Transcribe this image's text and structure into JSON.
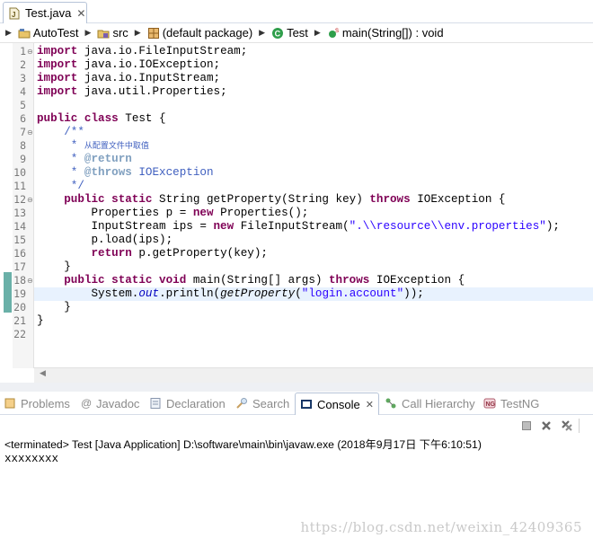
{
  "editor_tab": {
    "label": "Test.java",
    "close": "✕"
  },
  "breadcrumb": [
    {
      "label": "AutoTest",
      "icon": "project-icon"
    },
    {
      "label": "src",
      "icon": "source-folder-icon"
    },
    {
      "label": "(default package)",
      "icon": "package-icon"
    },
    {
      "label": "Test",
      "icon": "class-icon"
    },
    {
      "label": "main(String[]) : void",
      "icon": "method-icon"
    }
  ],
  "code_lines": [
    "1",
    "2",
    "3",
    "4",
    "5",
    "6",
    "7",
    "8",
    "9",
    "10",
    "11",
    "12",
    "13",
    "14",
    "15",
    "16",
    "17",
    "18",
    "19",
    "20",
    "21",
    "22"
  ],
  "code": {
    "l1": {
      "kw": "import",
      "rest": " java.io.FileInputStream;"
    },
    "l2": {
      "kw": "import",
      "rest": " java.io.IOException;"
    },
    "l3": {
      "kw": "import",
      "rest": " java.io.InputStream;"
    },
    "l4": {
      "kw": "import",
      "rest": " java.util.Properties;"
    },
    "l6": {
      "kw": "public class",
      "rest": " Test {"
    },
    "l7": "    /**",
    "l8": {
      "prefix": "     * ",
      "text": "从配置文件中取值"
    },
    "l9": {
      "prefix": "     * ",
      "tag": "@return"
    },
    "l10": {
      "prefix": "     * ",
      "tag": "@throws",
      "rest": " IOException"
    },
    "l11": "     */",
    "l12": {
      "indent": "    ",
      "kw": "public static",
      "mid": " String getProperty(String key) ",
      "kw2": "throws",
      "rest": " IOException {"
    },
    "l13": {
      "a": "        Properties p = ",
      "kw": "new",
      "b": " Properties();"
    },
    "l14": {
      "a": "        InputStream ips = ",
      "kw": "new",
      "b": " FileInputStream(",
      "str": "\".\\\\resource\\\\env.properties\"",
      "c": ");"
    },
    "l15": "        p.load(ips);",
    "l16": {
      "indent": "        ",
      "kw": "return",
      "rest": " p.getProperty(key);"
    },
    "l17": "    }",
    "l18": {
      "indent": "    ",
      "kw": "public static void",
      "mid": " main(String[] args) ",
      "kw2": "throws",
      "rest": " IOException {"
    },
    "l19": {
      "a": "        System.",
      "field": "out",
      "b": ".println(",
      "call": "getProperty",
      "c": "(",
      "str": "\"login.account\"",
      "d": "));"
    },
    "l20": "    }",
    "l21": "}"
  },
  "view_tabs": [
    {
      "label": "Problems",
      "icon": "problems-icon",
      "active": false
    },
    {
      "label": "Javadoc",
      "icon": "javadoc-icon",
      "active": false
    },
    {
      "label": "Declaration",
      "icon": "declaration-icon",
      "active": false
    },
    {
      "label": "Search",
      "icon": "search-icon",
      "active": false
    },
    {
      "label": "Console",
      "icon": "console-icon",
      "active": true
    },
    {
      "label": "Call Hierarchy",
      "icon": "call-hierarchy-icon",
      "active": false
    },
    {
      "label": "TestNG",
      "icon": "testng-icon",
      "active": false
    }
  ],
  "console": {
    "header": "<terminated> Test [Java Application] D:\\software\\main\\bin\\javaw.exe (2018年9月17日 下午6:10:51)",
    "output": "xxxxxxxx",
    "close": "✕"
  },
  "watermark": "https://blog.csdn.net/weixin_42409365",
  "colors": {
    "keyword": "#7f0055",
    "string": "#2a00ff",
    "javadoc": "#3f5fbf",
    "current_line": "#e8f2fe",
    "change_marker": "#6ab0a8"
  }
}
